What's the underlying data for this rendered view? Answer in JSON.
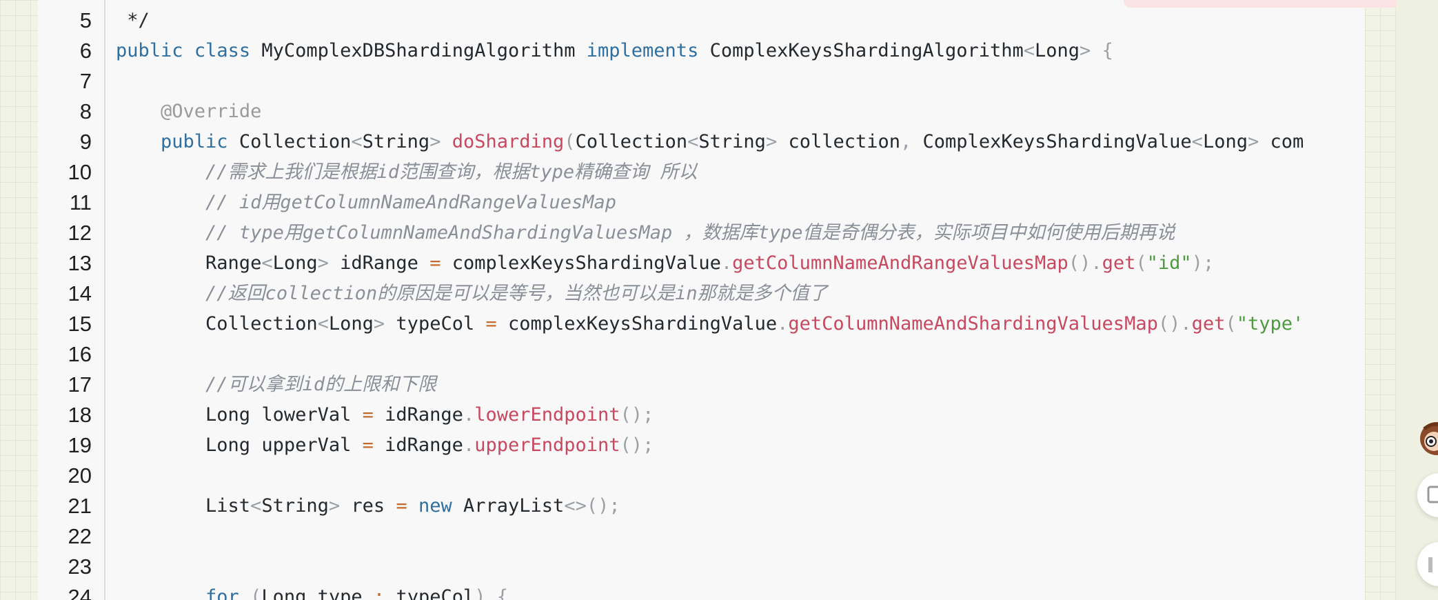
{
  "editor": {
    "line_numbers": [
      "5",
      "6",
      "7",
      "8",
      "9",
      "10",
      "11",
      "12",
      "13",
      "14",
      "15",
      "16",
      "17",
      "18",
      "19",
      "20",
      "21",
      "22",
      "23",
      "24"
    ],
    "lines": [
      " */",
      "public class MyComplexDBShardingAlgorithm implements ComplexKeysShardingAlgorithm<Long> {",
      "",
      "    @Override",
      "    public Collection<String> doSharding(Collection<String> collection, ComplexKeysShardingValue<Long> com",
      "        //需求上我们是根据id范围查询，根据type精确查询 所以",
      "        // id用getColumnNameAndRangeValuesMap",
      "        // type用getColumnNameAndShardingValuesMap ，数据库type值是奇偶分表，实际项目中如何使用后期再说",
      "        Range<Long> idRange = complexKeysShardingValue.getColumnNameAndRangeValuesMap().get(\"id\");",
      "        //返回collection的原因是可以是等号，当然也可以是in那就是多个值了",
      "        Collection<Long> typeCol = complexKeysShardingValue.getColumnNameAndShardingValuesMap().get(\"type'",
      "",
      "        //可以拿到id的上限和下限",
      "        Long lowerVal = idRange.lowerEndpoint();",
      "        Long upperVal = idRange.upperEndpoint();",
      "",
      "        List<String> res = new ArrayList<>();",
      "",
      "",
      "        for (Long type : typeCol) {"
    ]
  },
  "colors": {
    "keyword": "#2f6f9f",
    "method": "#c8485f",
    "string": "#4d9a3f",
    "comment": "#8a8f98",
    "annotation": "#9a9a9a",
    "operator": "#c46a2d"
  }
}
